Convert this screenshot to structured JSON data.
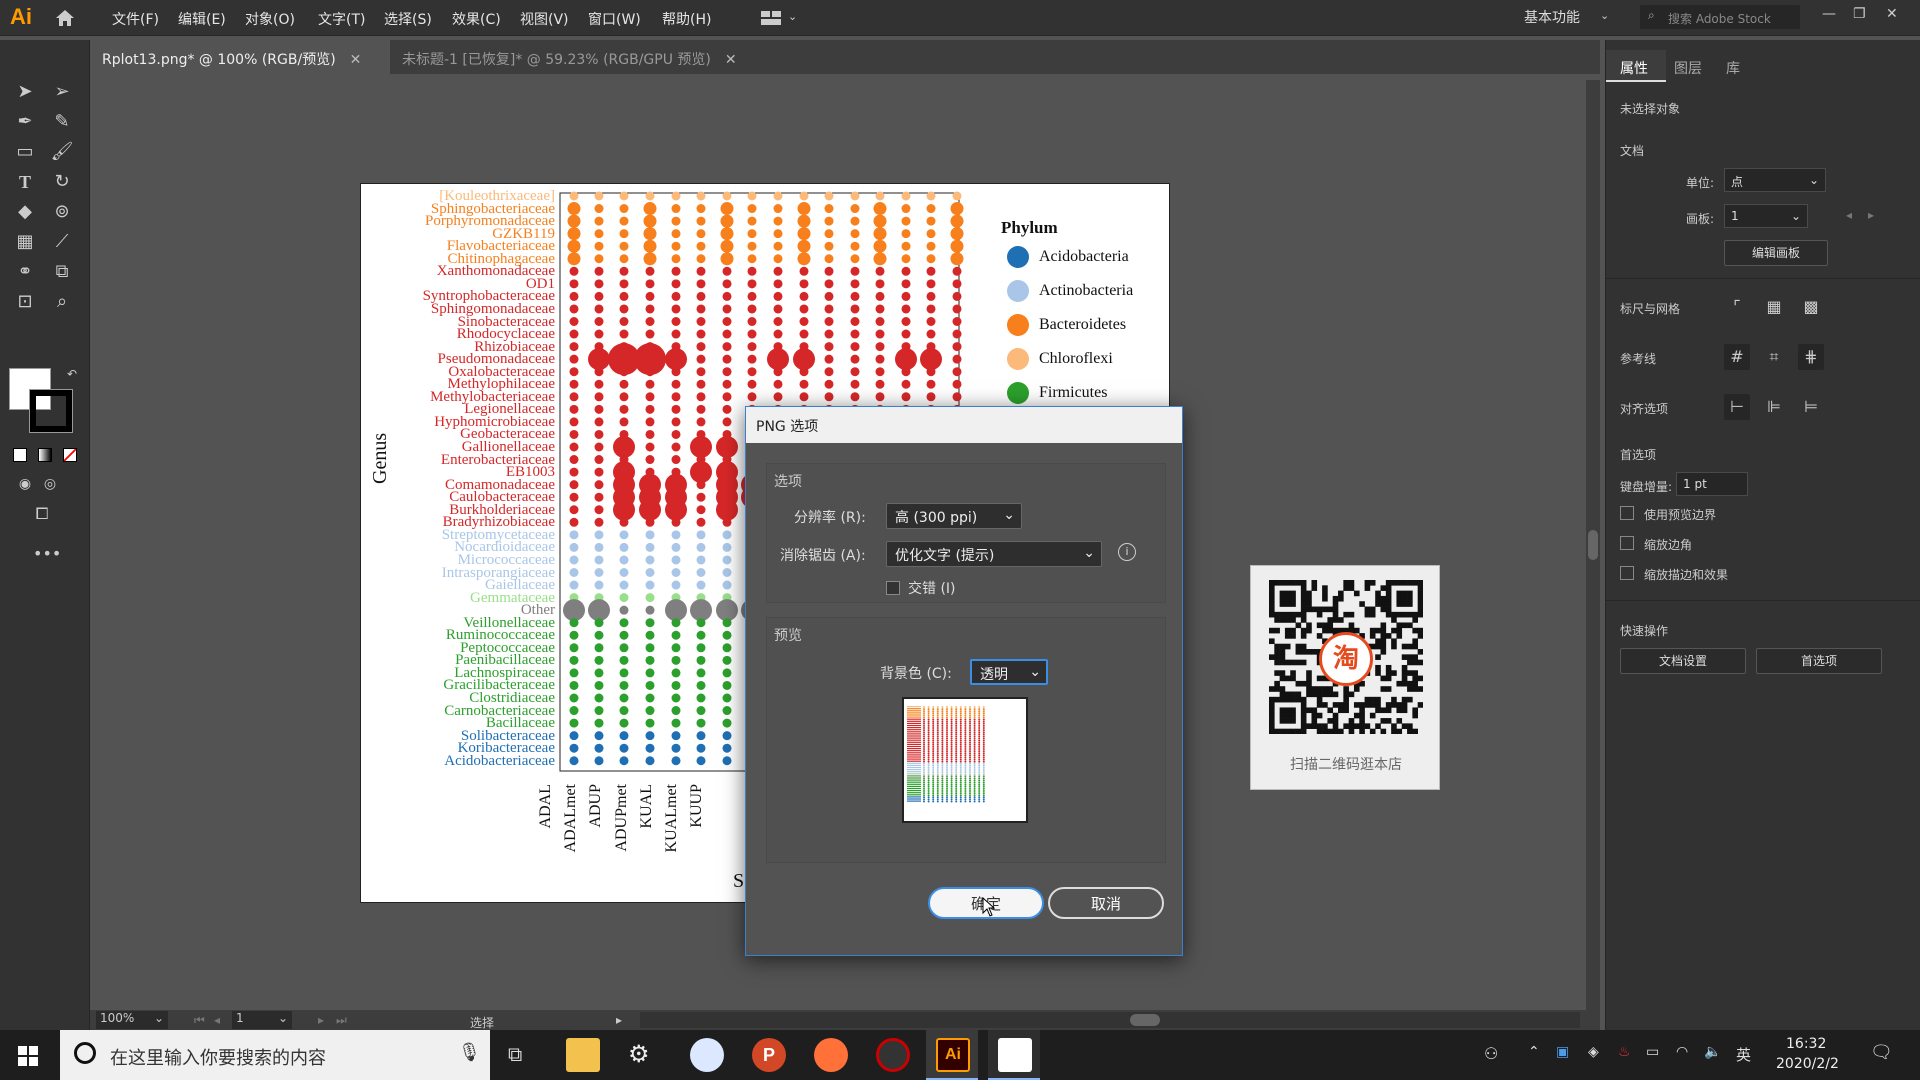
{
  "app": {
    "logo": "Ai"
  },
  "menu": [
    "文件(F)",
    "编辑(E)",
    "对象(O)",
    "文字(T)",
    "选择(S)",
    "效果(C)",
    "视图(V)",
    "窗口(W)",
    "帮助(H)"
  ],
  "workspace": "基本功能",
  "search_placeholder": "搜索 Adobe Stock",
  "tabs": [
    {
      "label": "Rplot13.png* @ 100% (RGB/预览)",
      "active": true
    },
    {
      "label": "未标题-1 [已恢复]* @ 59.23% (RGB/GPU 预览)",
      "active": false
    }
  ],
  "chart": {
    "genus_label": "Genus",
    "sample_label_fragment": "S",
    "legend_title": "Phylum",
    "legend": [
      {
        "name": "Acidobacteria",
        "color": "#1f6fb4"
      },
      {
        "name": "Actinobacteria",
        "color": "#a9c6e8"
      },
      {
        "name": "Bacteroidetes",
        "color": "#f7801d"
      },
      {
        "name": "Chloroflexi",
        "color": "#fbb97a"
      },
      {
        "name": "Firmicutes",
        "color": "#2ca02c"
      }
    ],
    "samples": [
      "ADAL",
      "ADALmet",
      "ADUP",
      "ADUPmet",
      "KUAL",
      "KUALmet",
      "KUUP"
    ],
    "genera": [
      {
        "name": "[Kouleothrixaceae]",
        "color": "#fbb97a"
      },
      {
        "name": "Sphingobacteriaceae",
        "color": "#f7801d"
      },
      {
        "name": "Porphyromonadaceae",
        "color": "#f7801d"
      },
      {
        "name": "GZKB119",
        "color": "#f7801d"
      },
      {
        "name": "Flavobacteriaceae",
        "color": "#f7801d"
      },
      {
        "name": "Chitinophagaceae",
        "color": "#f7801d"
      },
      {
        "name": "Xanthomonadaceae",
        "color": "#d62728"
      },
      {
        "name": "OD1",
        "color": "#d62728"
      },
      {
        "name": "Syntrophobacteraceae",
        "color": "#d62728"
      },
      {
        "name": "Sphingomonadaceae",
        "color": "#d62728"
      },
      {
        "name": "Sinobacteraceae",
        "color": "#d62728"
      },
      {
        "name": "Rhodocyclaceae",
        "color": "#d62728"
      },
      {
        "name": "Rhizobiaceae",
        "color": "#d62728"
      },
      {
        "name": "Pseudomonadaceae",
        "color": "#d62728"
      },
      {
        "name": "Oxalobacteraceae",
        "color": "#d62728"
      },
      {
        "name": "Methylophilaceae",
        "color": "#d62728"
      },
      {
        "name": "Methylobacteriaceae",
        "color": "#d62728"
      },
      {
        "name": "Legionellaceae",
        "color": "#d62728"
      },
      {
        "name": "Hyphomicrobiaceae",
        "color": "#d62728"
      },
      {
        "name": "Geobacteraceae",
        "color": "#d62728"
      },
      {
        "name": "Gallionellaceae",
        "color": "#d62728"
      },
      {
        "name": "Enterobacteriaceae",
        "color": "#d62728"
      },
      {
        "name": "EB1003",
        "color": "#d62728"
      },
      {
        "name": "Comamonadaceae",
        "color": "#d62728"
      },
      {
        "name": "Caulobacteraceae",
        "color": "#d62728"
      },
      {
        "name": "Burkholderiaceae",
        "color": "#d62728"
      },
      {
        "name": "Bradyrhizobiaceae",
        "color": "#d62728"
      },
      {
        "name": "Streptomycetaceae",
        "color": "#a9c6e8"
      },
      {
        "name": "Nocardioidaceae",
        "color": "#a9c6e8"
      },
      {
        "name": "Micrococcaceae",
        "color": "#a9c6e8"
      },
      {
        "name": "Intrasporangiaceae",
        "color": "#a9c6e8"
      },
      {
        "name": "Gaiellaceae",
        "color": "#a9c6e8"
      },
      {
        "name": "Gemmataceae",
        "color": "#98df8a"
      },
      {
        "name": "Other",
        "color": "#7f7f7f"
      },
      {
        "name": "Veillonellaceae",
        "color": "#2ca02c"
      },
      {
        "name": "Ruminococcaceae",
        "color": "#2ca02c"
      },
      {
        "name": "Peptococcaceae",
        "color": "#2ca02c"
      },
      {
        "name": "Paenibacillaceae",
        "color": "#2ca02c"
      },
      {
        "name": "Lachnospiraceae",
        "color": "#2ca02c"
      },
      {
        "name": "Gracilibacteraceae",
        "color": "#2ca02c"
      },
      {
        "name": "Clostridiaceae",
        "color": "#2ca02c"
      },
      {
        "name": "Carnobacteriaceae",
        "color": "#2ca02c"
      },
      {
        "name": "Bacillaceae",
        "color": "#2ca02c"
      },
      {
        "name": "Solibacteraceae",
        "color": "#1f6fb4"
      },
      {
        "name": "Koribacteraceae",
        "color": "#1f6fb4"
      },
      {
        "name": "Acidobacteriaceae",
        "color": "#1f6fb4"
      }
    ]
  },
  "qr": {
    "caption": "扫描二维码逛本店",
    "center_char": "淘"
  },
  "dialog": {
    "title": "PNG 选项",
    "options_section": "选项",
    "resolution_label": "分辨率 (R):",
    "resolution_value": "高 (300 ppi)",
    "antialias_label": "消除锯齿 (A):",
    "antialias_value": "优化文字 (提示)",
    "interlace_label": "交错 (I)",
    "preview_section": "预览",
    "bg_label": "背景色 (C):",
    "bg_value": "透明",
    "ok": "确定",
    "cancel": "取消"
  },
  "right_panel": {
    "tabs": [
      "属性",
      "图层",
      "库"
    ],
    "no_selection": "未选择对象",
    "document": "文档",
    "unit_label": "单位:",
    "unit_value": "点",
    "artboard_label": "画板:",
    "artboard_value": "1",
    "edit_artboard": "编辑画板",
    "rulers_grids": "标尺与网格",
    "guides": "参考线",
    "align_options": "对齐选项",
    "preferences": "首选项",
    "keyboard_inc_label": "键盘增量:",
    "keyboard_inc_value": "1 pt",
    "checkboxes": [
      "使用预览边界",
      "缩放边角",
      "缩放描边和效果"
    ],
    "quick_actions": "快速操作",
    "doc_settings": "文档设置",
    "prefs_button": "首选项"
  },
  "status": {
    "zoom": "100%",
    "artboard": "1",
    "tool": "选择"
  },
  "taskbar": {
    "search_placeholder": "在这里输入你要搜索的内容",
    "time": "16:32",
    "date": "2020/2/2",
    "ime": "英"
  }
}
